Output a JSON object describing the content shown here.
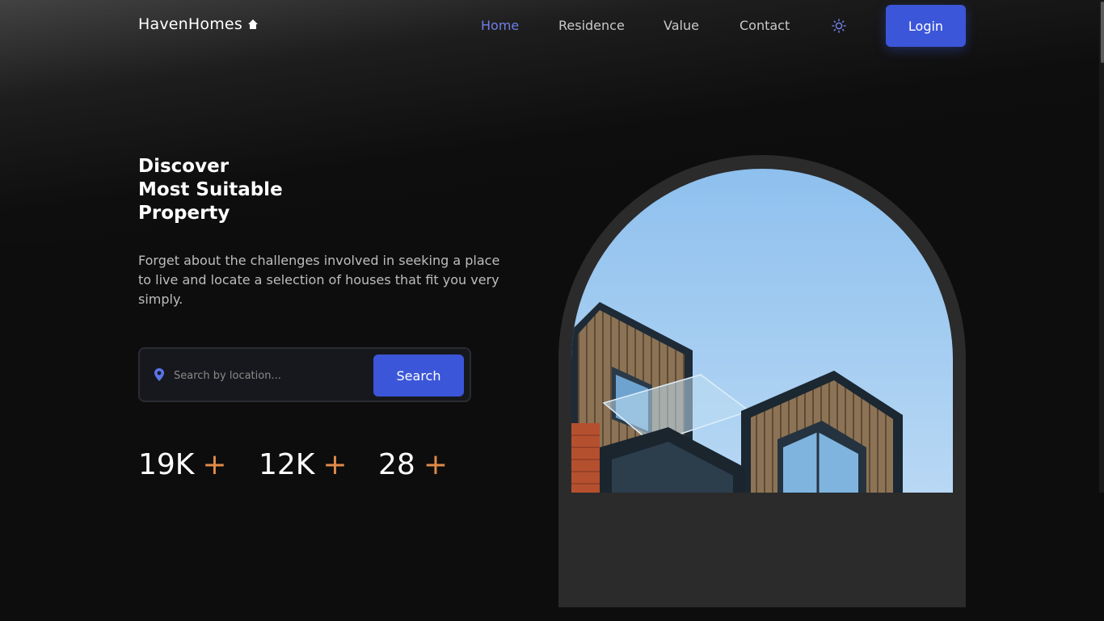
{
  "brand": {
    "name": "HavenHomes",
    "icon": "home-icon"
  },
  "nav": {
    "items": [
      {
        "label": "Home",
        "active": true
      },
      {
        "label": "Residence",
        "active": false
      },
      {
        "label": "Value",
        "active": false
      },
      {
        "label": "Contact",
        "active": false
      }
    ],
    "theme_icon": "sun-icon",
    "login_label": "Login"
  },
  "hero": {
    "title_lines": [
      "Discover",
      "Most Suitable",
      "Property"
    ],
    "description": "Forget about the challenges involved in seeking a place to live and locate a selection of houses that fit you very simply.",
    "search": {
      "icon": "location-pin-icon",
      "placeholder": "Search by location...",
      "button_label": "Search"
    },
    "stats": [
      {
        "value": "19K",
        "suffix": "+"
      },
      {
        "value": "12K",
        "suffix": "+"
      },
      {
        "value": "28",
        "suffix": "+"
      }
    ]
  },
  "colors": {
    "accent": "#3b56d9",
    "active_nav": "#6f7fe8",
    "stat_plus": "#e08a4a",
    "background": "#0d0d0d"
  }
}
